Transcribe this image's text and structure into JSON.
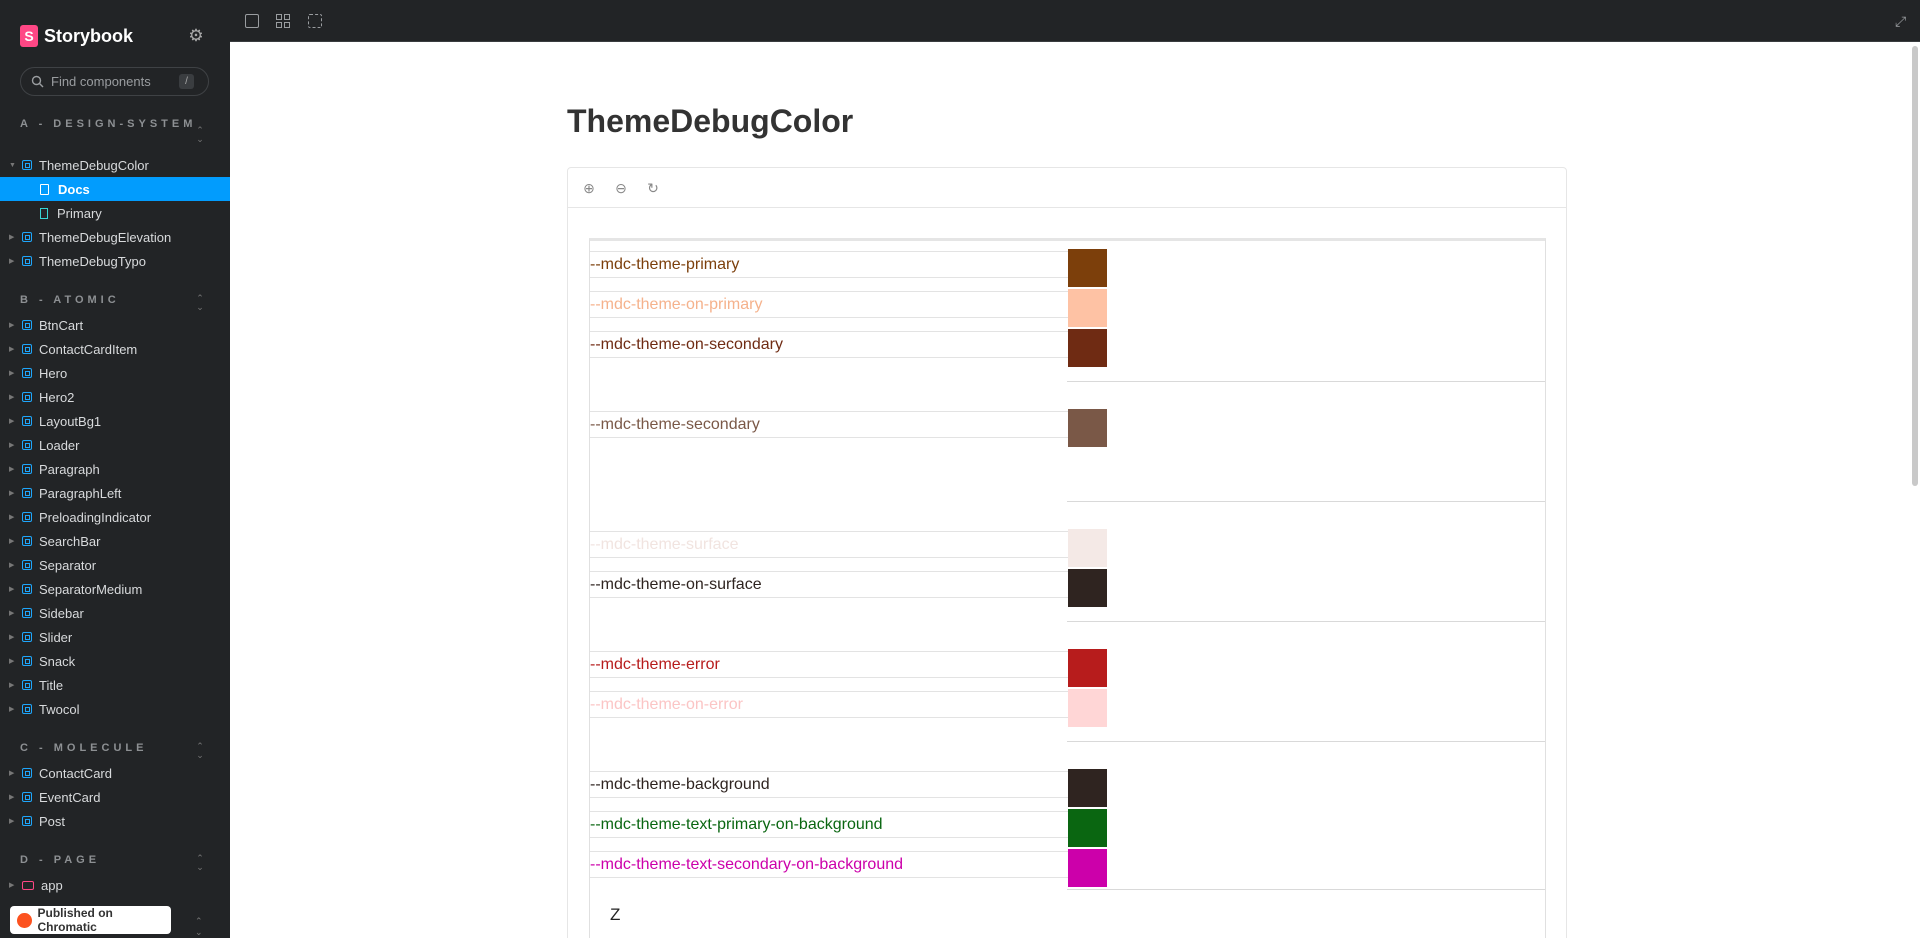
{
  "brand": {
    "name": "Storybook",
    "logo_letter": "S"
  },
  "search": {
    "placeholder": "Find components",
    "shortcut": "/"
  },
  "groups": [
    {
      "label": "A - DESIGN-SYSTEM"
    },
    {
      "label": "B - ATOMIC"
    },
    {
      "label": "C - MOLECULE"
    },
    {
      "label": "D - PAGE"
    }
  ],
  "nav": {
    "design": [
      "ThemeDebugColor",
      "Docs",
      "Primary",
      "ThemeDebugElevation",
      "ThemeDebugTypo"
    ],
    "atomic": [
      "BtnCart",
      "ContactCardItem",
      "Hero",
      "Hero2",
      "LayoutBg1",
      "Loader",
      "Paragraph",
      "ParagraphLeft",
      "PreloadingIndicator",
      "SearchBar",
      "Separator",
      "SeparatorMedium",
      "Sidebar",
      "Slider",
      "Snack",
      "Title",
      "Twocol"
    ],
    "molecule": [
      "ContactCard",
      "EventCard",
      "Post"
    ],
    "page": [
      "app"
    ]
  },
  "chromatic": {
    "label": "Published on Chromatic"
  },
  "page": {
    "title": "ThemeDebugColor"
  },
  "colors": [
    {
      "name": "--mdc-theme-primary",
      "text": "#7c3f0b",
      "swatch": "#7c3f0b"
    },
    {
      "name": "--mdc-theme-on-primary",
      "text": "#f5b28c",
      "swatch": "#fec2a4"
    },
    {
      "name": "--mdc-theme-on-secondary",
      "text": "#6f2b13",
      "swatch": "#6f2b13"
    },
    {
      "name": "--mdc-theme-secondary",
      "text": "#7a5847",
      "swatch": "#7a5847"
    },
    {
      "name": "--mdc-theme-surface",
      "text": "#f1e4e0",
      "swatch": "#f4e9e6"
    },
    {
      "name": "--mdc-theme-on-surface",
      "text": "#2f2420",
      "swatch": "#2f2420"
    },
    {
      "name": "--mdc-theme-error",
      "text": "#b71c1c",
      "swatch": "#b71c1c"
    },
    {
      "name": "--mdc-theme-on-error",
      "text": "#fbc5c5",
      "swatch": "#ffd6d6"
    },
    {
      "name": "--mdc-theme-background",
      "text": "#2f2420",
      "swatch": "#2f2420"
    },
    {
      "name": "--mdc-theme-text-primary-on-background",
      "text": "#0a6611",
      "swatch": "#0a6611"
    },
    {
      "name": "--mdc-theme-text-secondary-on-background",
      "text": "#cc00aa",
      "swatch": "#cc00aa"
    }
  ],
  "trailing_letter": "Z"
}
